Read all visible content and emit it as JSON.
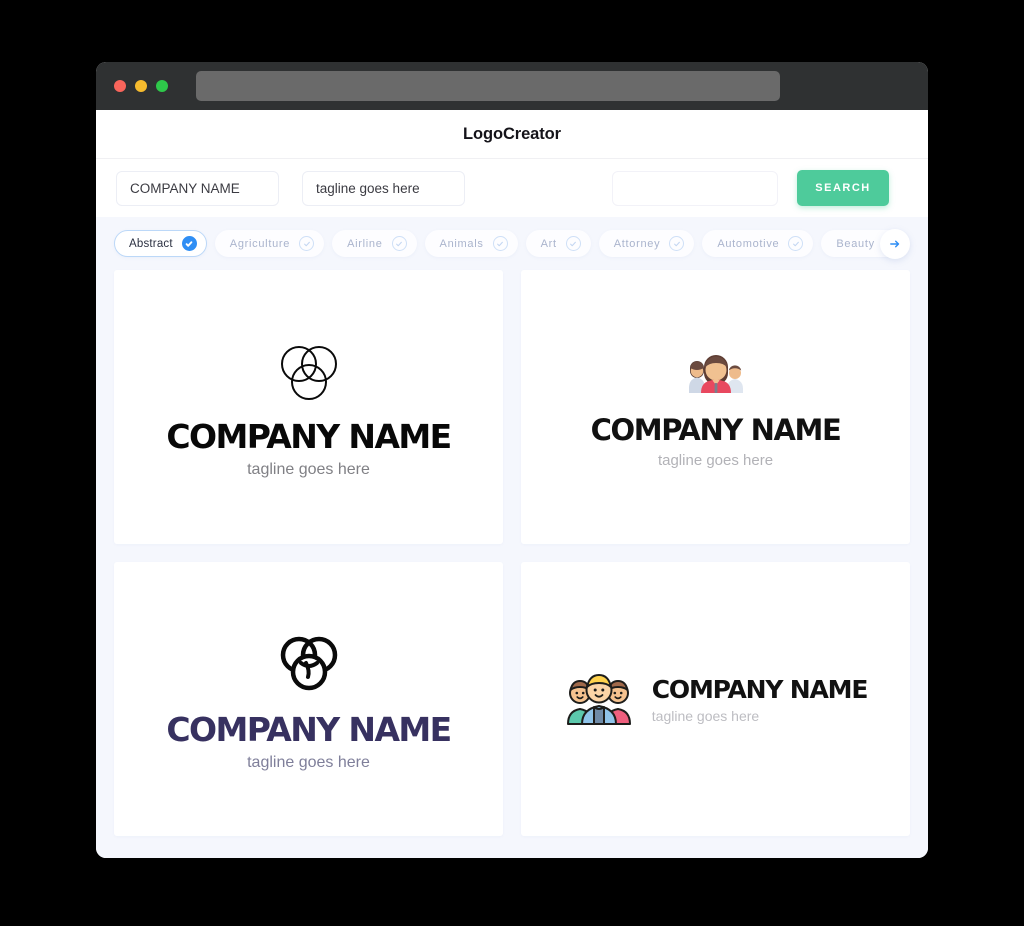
{
  "window": {
    "traffic_lights": [
      "close",
      "minimize",
      "maximize"
    ],
    "url_value": ""
  },
  "header": {
    "title": "LogoCreator"
  },
  "search": {
    "company_value": "COMPANY NAME",
    "company_placeholder": "COMPANY NAME",
    "tagline_value": "tagline goes here",
    "tagline_placeholder": "tagline goes here",
    "keyword_value": "",
    "keyword_placeholder": "",
    "button_label": "SEARCH",
    "button_color": "#4ecb9b"
  },
  "tabs": {
    "next_icon": "arrow-right-icon",
    "active_color": "#2f8ef4",
    "items": [
      {
        "label": "Abstract",
        "selected": true
      },
      {
        "label": "Agriculture",
        "selected": false
      },
      {
        "label": "Airline",
        "selected": false
      },
      {
        "label": "Animals",
        "selected": false
      },
      {
        "label": "Art",
        "selected": false
      },
      {
        "label": "Attorney",
        "selected": false
      },
      {
        "label": "Automotive",
        "selected": false
      },
      {
        "label": "Beauty",
        "selected": false
      }
    ]
  },
  "logos": [
    {
      "mark": "three-circles-outline-icon",
      "name": "COMPANY NAME",
      "tagline": "tagline goes here",
      "name_color": "#080808",
      "tagline_color": "#808085",
      "layout": "stacked"
    },
    {
      "mark": "people-group-flat-icon",
      "name": "COMPANY NAME",
      "tagline": "tagline goes here",
      "name_color": "#111111",
      "tagline_color": "#b2b2b7",
      "layout": "stacked"
    },
    {
      "mark": "three-circles-bold-icon",
      "name": "COMPANY NAME",
      "tagline": "tagline goes here",
      "name_color": "#373160",
      "tagline_color": "#7f7f9a",
      "layout": "stacked"
    },
    {
      "mark": "people-trio-cartoon-icon",
      "name": "COMPANY NAME",
      "tagline": "tagline goes here",
      "name_color": "#111111",
      "tagline_color": "#bdbdc2",
      "layout": "inline"
    }
  ]
}
